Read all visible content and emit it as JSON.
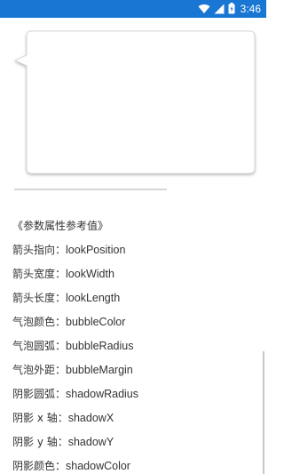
{
  "status_bar": {
    "time": "3:46",
    "icons": [
      "wifi-icon",
      "signal-icon",
      "battery-icon"
    ],
    "background": "#1976d2"
  },
  "bubble": {
    "fill": "#ffffff",
    "border": "#d0d0d0",
    "shadow": "#bdbdbd"
  },
  "params": {
    "title": "《参数属性参考值》",
    "items": [
      {
        "key": "箭头指向：",
        "value": "lookPosition"
      },
      {
        "key": "箭头宽度：",
        "value": "lookWidth"
      },
      {
        "key": "箭头长度：",
        "value": "lookLength"
      },
      {
        "key": "气泡颜色：",
        "value": "bubbleColor"
      },
      {
        "key": "气泡圆弧：",
        "value": "bubbleRadius"
      },
      {
        "key": "气泡外距：",
        "value": "bubbleMargin"
      },
      {
        "key": "阴影圆弧：",
        "value": "shadowRadius"
      },
      {
        "key": "阴影 x 轴：",
        "value": "shadowX"
      },
      {
        "key": "阴影 y 轴：",
        "value": "shadowY"
      },
      {
        "key": "阴影颜色：",
        "value": "shadowColor"
      }
    ]
  }
}
